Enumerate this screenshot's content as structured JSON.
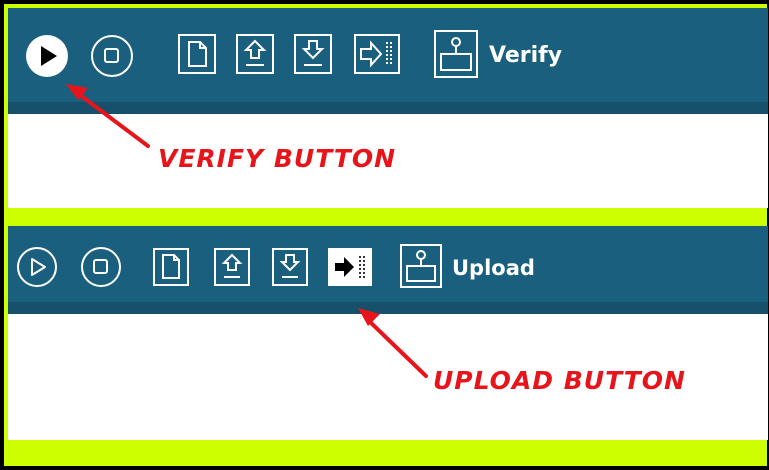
{
  "colors": {
    "frame_background": "#ccff00",
    "border": "#000000",
    "toolbar": "#1b5f7e",
    "icon_outline": "#ffffff",
    "annotation": "#e8141b"
  },
  "top_panel": {
    "toolbar_label": "Verify",
    "active_button": "verify",
    "buttons": [
      "verify-icon",
      "stop-icon",
      "new-file-icon",
      "open-icon",
      "save-icon",
      "upload-icon",
      "serial-monitor-icon"
    ],
    "annotation": "Verify Button"
  },
  "bottom_panel": {
    "toolbar_label": "Upload",
    "active_button": "upload",
    "buttons": [
      "verify-icon",
      "stop-icon",
      "new-file-icon",
      "open-icon",
      "save-icon",
      "upload-icon",
      "serial-monitor-icon"
    ],
    "annotation": "Upload Button"
  }
}
